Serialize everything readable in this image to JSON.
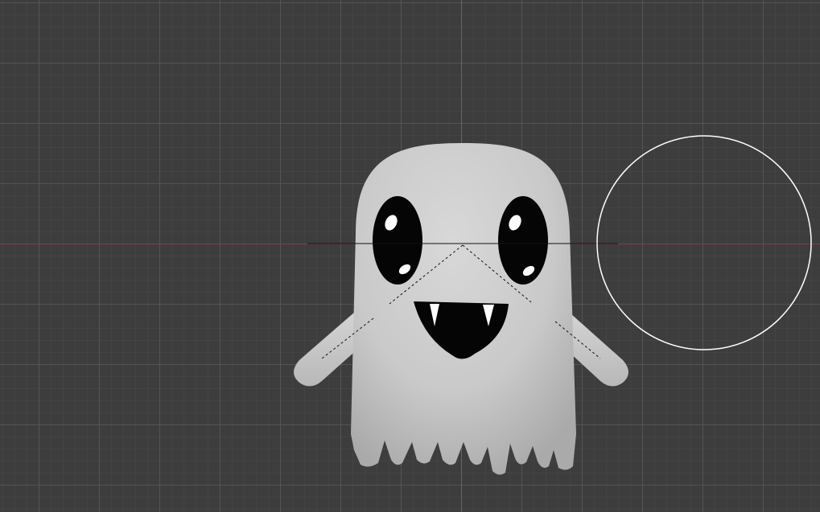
{
  "viewport": {
    "background": "#3d3d3d",
    "grid_major_color": "#555555",
    "grid_minor_color": "#464646",
    "x_axis_color": "#8a3a45",
    "y_axis_color": "#3f6da8"
  },
  "character": {
    "name_icon": "ghost-model-icon",
    "body_color": "#cfcfcf",
    "eye_color": "#050505",
    "mouth_color": "#050505"
  },
  "light": {
    "icon": "area-light-circle-icon",
    "color": "#ffffff"
  },
  "camera_gizmo": {
    "icon": "dashed-cone-gizmo-icon"
  }
}
